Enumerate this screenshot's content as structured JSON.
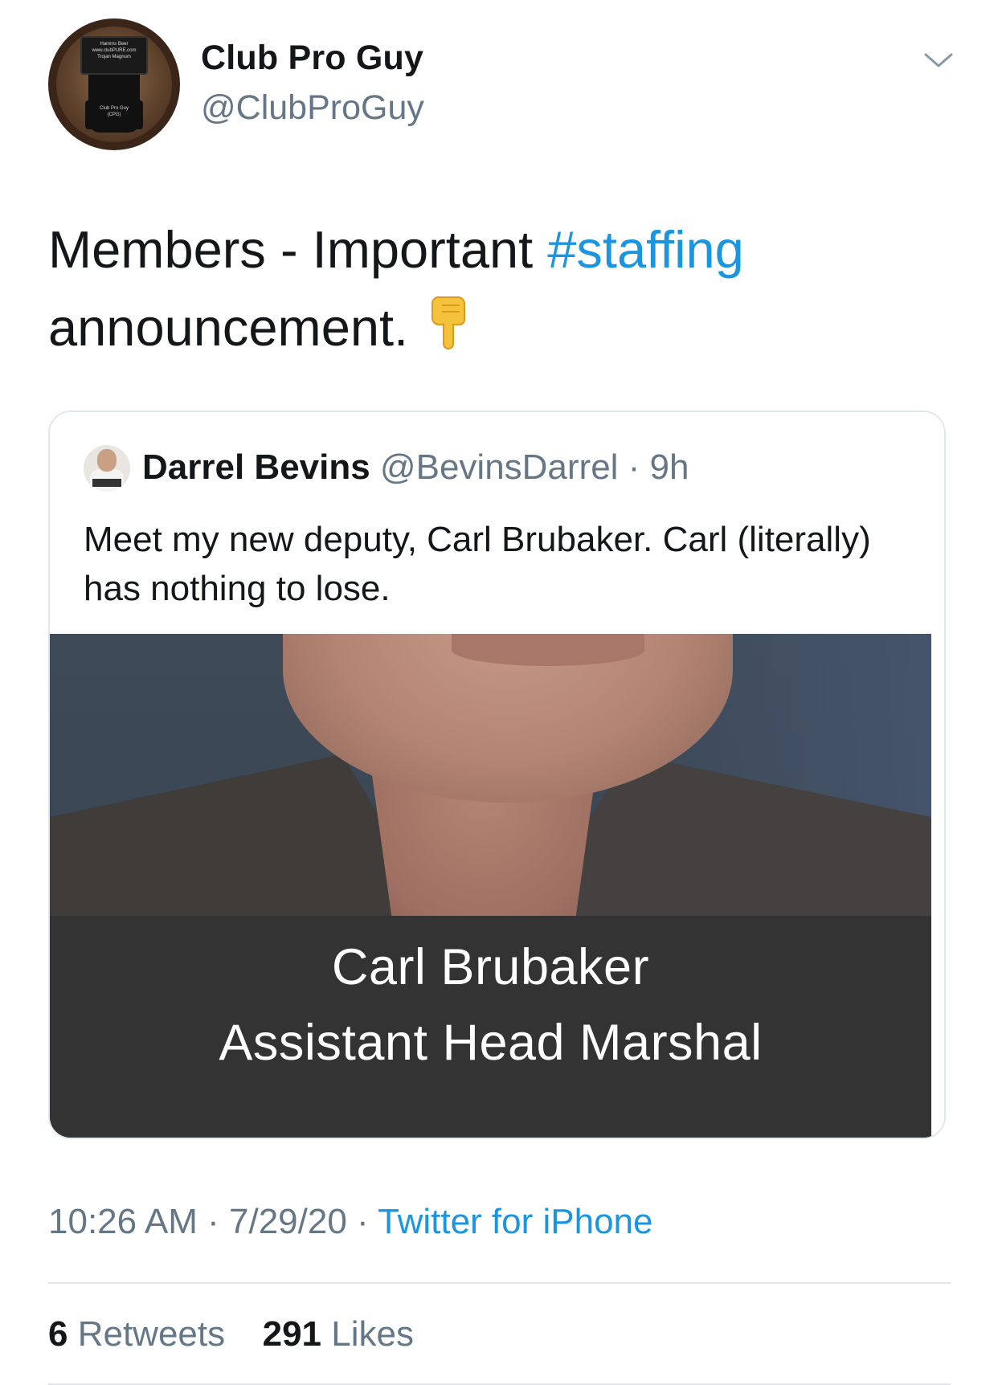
{
  "author": {
    "display_name": "Club Pro Guy",
    "handle": "@ClubProGuy",
    "avatar_lines": [
      "Hamms Beer",
      "www.clubPURE.com",
      "Trojan Magnum",
      "Club Pro Guy",
      "(CPG)"
    ]
  },
  "tweet": {
    "text_before": "Members - Important ",
    "hashtag": "#staffing",
    "text_after": "announcement.",
    "emoji": "👇"
  },
  "quoted": {
    "display_name": "Darrel Bevins",
    "handle_time": " @BevinsDarrel · 9h",
    "text": "Meet my new deputy, Carl Brubaker. Carl (literally) has nothing to lose.",
    "image_caption_name": "Carl Brubaker",
    "image_caption_title": "Assistant Head Marshal"
  },
  "meta": {
    "time_date": "10:26 AM · 7/29/20 · ",
    "source": "Twitter for iPhone"
  },
  "stats": {
    "retweets_count": "6",
    "retweets_label": " Retweets",
    "likes_count": "291",
    "likes_label": " Likes"
  },
  "colors": {
    "link": "#1b95e0",
    "secondary_text": "#657786",
    "border": "#e1e8ed"
  },
  "icons": {
    "more_menu": "chevron-down-icon"
  }
}
